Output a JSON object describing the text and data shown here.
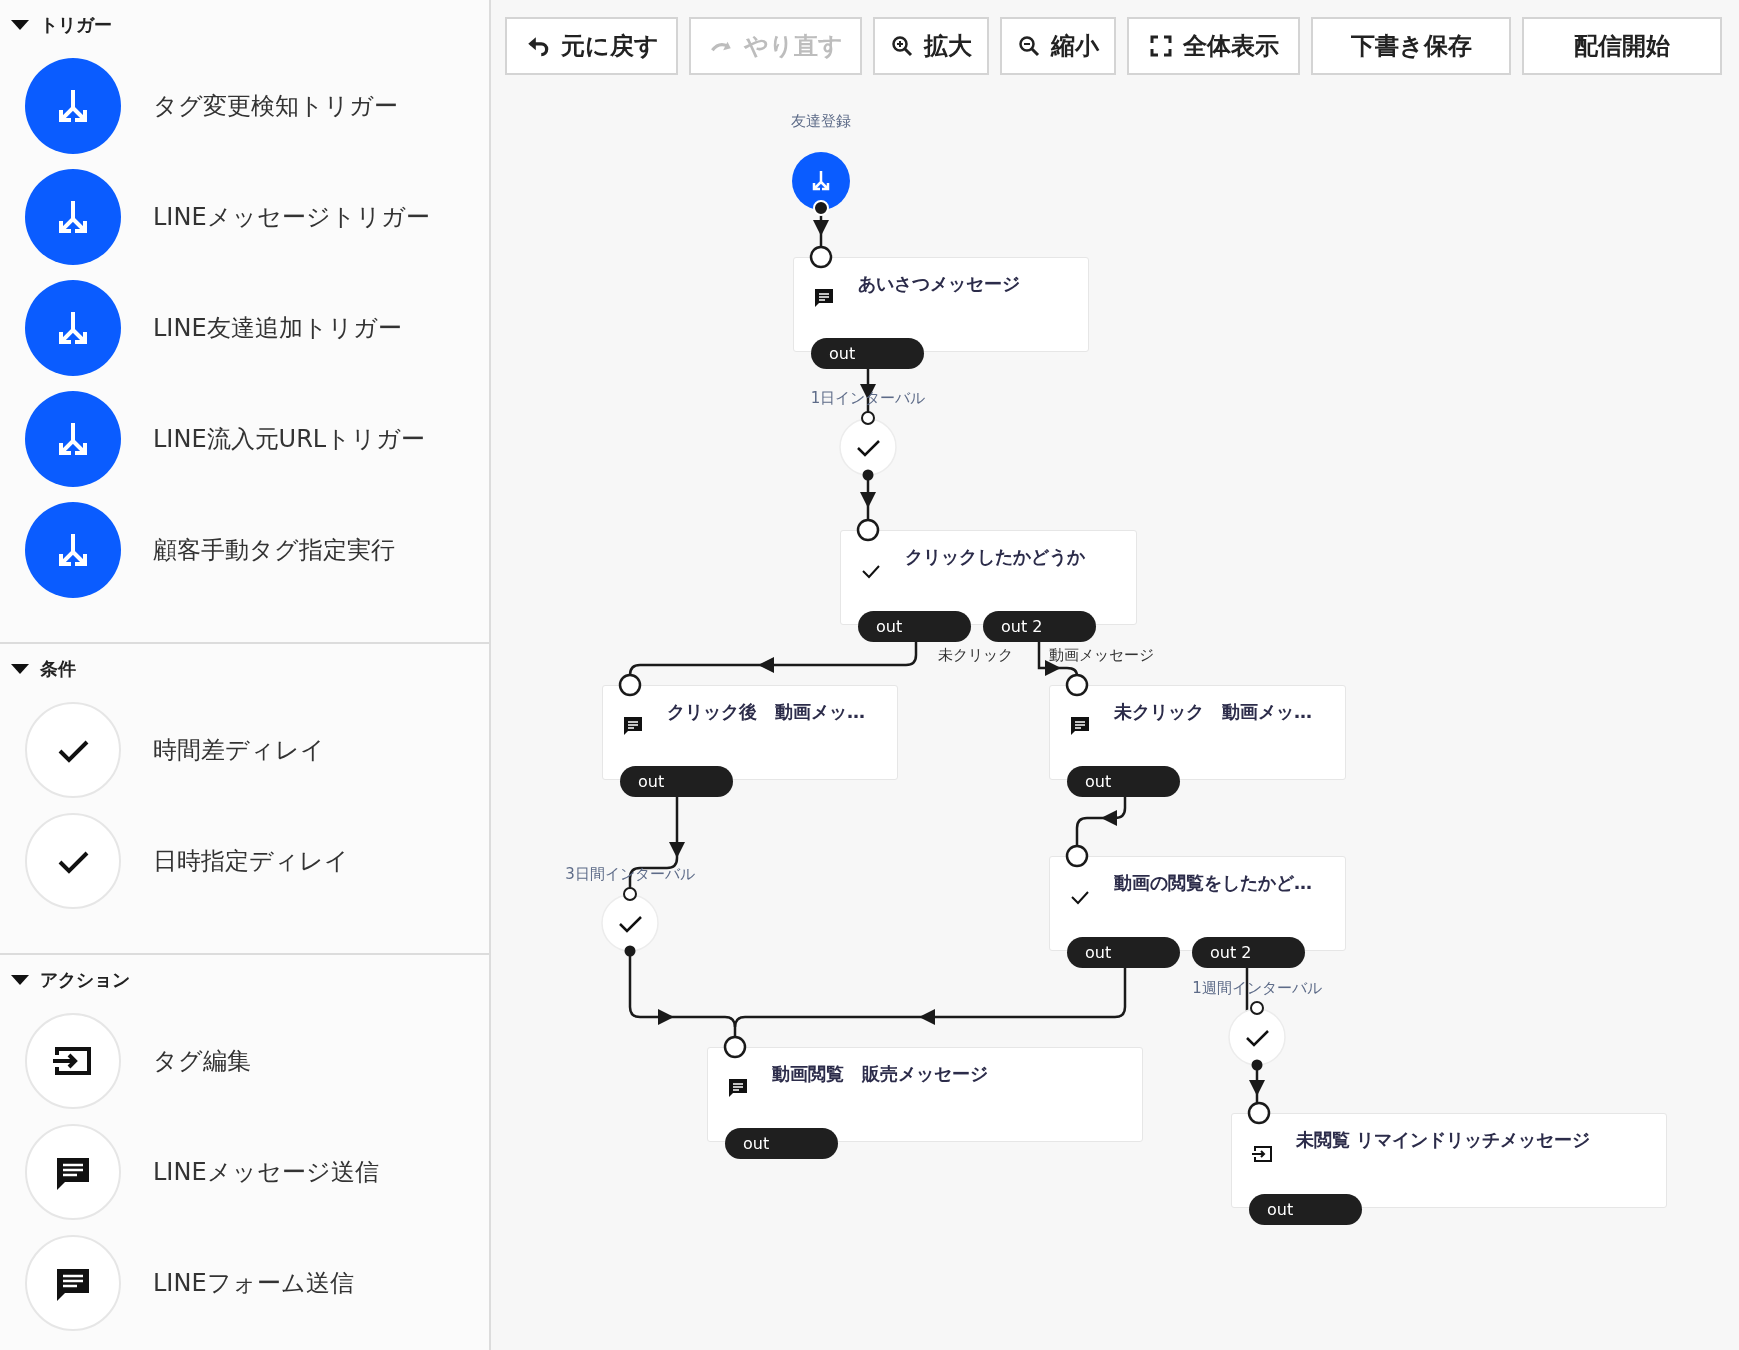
{
  "sidebar": {
    "sections": [
      {
        "title": "トリガー",
        "expanded": true,
        "items": [
          {
            "label": "タグ変更検知トリガー",
            "kind": "trigger"
          },
          {
            "label": "LINEメッセージトリガー",
            "kind": "trigger"
          },
          {
            "label": "LINE友達追加トリガー",
            "kind": "trigger"
          },
          {
            "label": "LINE流入元URLトリガー",
            "kind": "trigger"
          },
          {
            "label": "顧客手動タグ指定実行",
            "kind": "trigger"
          }
        ]
      },
      {
        "title": "条件",
        "expanded": true,
        "items": [
          {
            "label": "時間差ディレイ",
            "kind": "delay"
          },
          {
            "label": "日時指定ディレイ",
            "kind": "delay"
          }
        ]
      },
      {
        "title": "アクション",
        "expanded": true,
        "items": [
          {
            "label": "タグ編集",
            "kind": "tag"
          },
          {
            "label": "LINEメッセージ送信",
            "kind": "message"
          },
          {
            "label": "LINEフォーム送信",
            "kind": "message"
          }
        ]
      }
    ]
  },
  "toolbar": {
    "buttons": [
      {
        "label": "元に戻す",
        "kind": "undo",
        "disabled": false
      },
      {
        "label": "やり直す",
        "kind": "redo",
        "disabled": true
      },
      {
        "label": "拡大",
        "kind": "zoom-in",
        "disabled": false
      },
      {
        "label": "縮小",
        "kind": "zoom-out",
        "disabled": false
      },
      {
        "label": "全体表示",
        "kind": "fit",
        "disabled": false
      },
      {
        "label": "下書き保存",
        "kind": "plain",
        "disabled": false
      },
      {
        "label": "配信開始",
        "kind": "plain",
        "disabled": false
      }
    ]
  },
  "canvas": {
    "start": {
      "label": "友達登録"
    },
    "nodes": [
      {
        "kind": "message",
        "title": "あいさつメッセージ",
        "outputs": [
          "out"
        ]
      },
      {
        "kind": "condition",
        "title": "クリックしたかどうか",
        "outputs": [
          "out",
          "out 2"
        ]
      },
      {
        "kind": "message",
        "title": "クリック後　動画メッ…",
        "outputs": [
          "out"
        ]
      },
      {
        "kind": "message",
        "title": "未クリック　動画メッ…",
        "outputs": [
          "out"
        ]
      },
      {
        "kind": "condition",
        "title": "動画の閲覧をしたかど…",
        "outputs": [
          "out",
          "out 2"
        ]
      },
      {
        "kind": "message",
        "title": "動画閲覧　販売メッセージ",
        "outputs": [
          "out"
        ]
      },
      {
        "kind": "tag",
        "title": "未閲覧 リマインドリッチメッセージ",
        "outputs": [
          "out"
        ]
      }
    ],
    "delays": [
      {
        "label": "1日インターバル"
      },
      {
        "label": "3日間インターバル"
      },
      {
        "label": "1週間インターバル"
      }
    ],
    "edge_labels": [
      "未クリック",
      "動画メッセージ"
    ]
  }
}
